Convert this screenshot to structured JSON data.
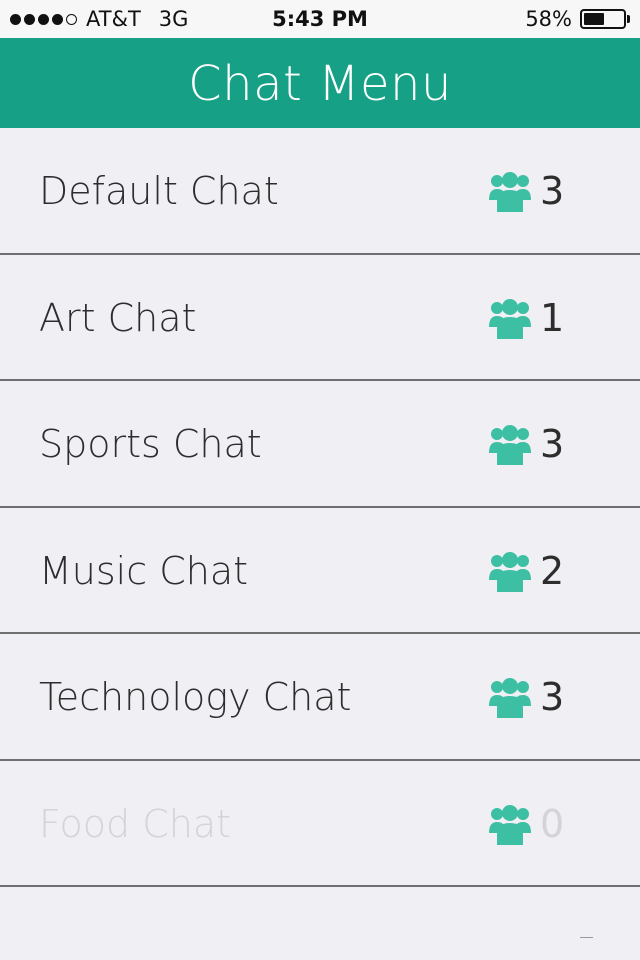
{
  "status_bar": {
    "carrier": "AT&T",
    "network": "3G",
    "time": "5:43 PM",
    "battery": "58%",
    "battery_level": 0.58,
    "signal_bars_filled": 4,
    "signal_bars_total": 5
  },
  "header": {
    "title": "Chat Menu",
    "color": "#16a085"
  },
  "chats": [
    {
      "name": "Default Chat",
      "count": "3",
      "enabled": true
    },
    {
      "name": "Art Chat",
      "count": "1",
      "enabled": true
    },
    {
      "name": "Sports Chat",
      "count": "3",
      "enabled": true
    },
    {
      "name": "Music Chat",
      "count": "2",
      "enabled": true
    },
    {
      "name": "Technology Chat",
      "count": "3",
      "enabled": true
    },
    {
      "name": "Food Chat",
      "count": "0",
      "enabled": false
    }
  ],
  "icons": {
    "users": "users-icon"
  },
  "colors": {
    "icon": "#3cbfa3",
    "text": "#2d2d2d",
    "disabled_text": "#d4d4d6",
    "background": "#efeff4"
  }
}
